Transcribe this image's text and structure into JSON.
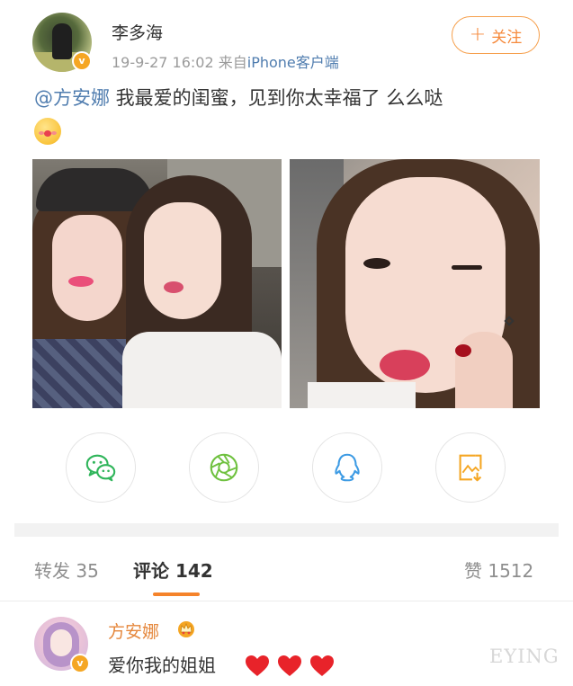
{
  "post": {
    "author": {
      "name": "李多海",
      "verified_badge": "v"
    },
    "meta": {
      "time": "19-9-27 16:02",
      "from_prefix": "来自",
      "source": "iPhone客户端"
    },
    "follow_button": {
      "plus": "+",
      "label": "关注"
    },
    "content": {
      "mention": "@方安娜",
      "text": " 我最爱的闺蜜，见到你太幸福了 么么哒"
    },
    "emoji_icon": "kiss-emoji-icon",
    "photos": [
      "selfie-two-women",
      "wink-kiss-selfie"
    ]
  },
  "share_buttons": [
    {
      "name": "wechat",
      "icon": "wechat-icon",
      "color": "#2fb55a"
    },
    {
      "name": "moments",
      "icon": "moments-icon",
      "color": "#6fc13f"
    },
    {
      "name": "qq",
      "icon": "qq-icon",
      "color": "#3d9be4"
    },
    {
      "name": "save-image",
      "icon": "save-image-icon",
      "color": "#f5a623"
    }
  ],
  "tabs": {
    "repost": {
      "label": "转发",
      "count": "35"
    },
    "comments": {
      "label": "评论",
      "count": "142"
    },
    "likes": {
      "label": "赞",
      "count": "1512"
    }
  },
  "comment": {
    "author": "方安娜",
    "verified_badge": "v",
    "text": "爱你我的姐姐",
    "hearts": 3,
    "crown_icon": "crown-icon"
  },
  "watermark": "EYING",
  "colors": {
    "accent_orange": "#f5832a",
    "link_blue": "#507daf",
    "verified_gold": "#f5a623",
    "heart_red": "#e8232a"
  }
}
